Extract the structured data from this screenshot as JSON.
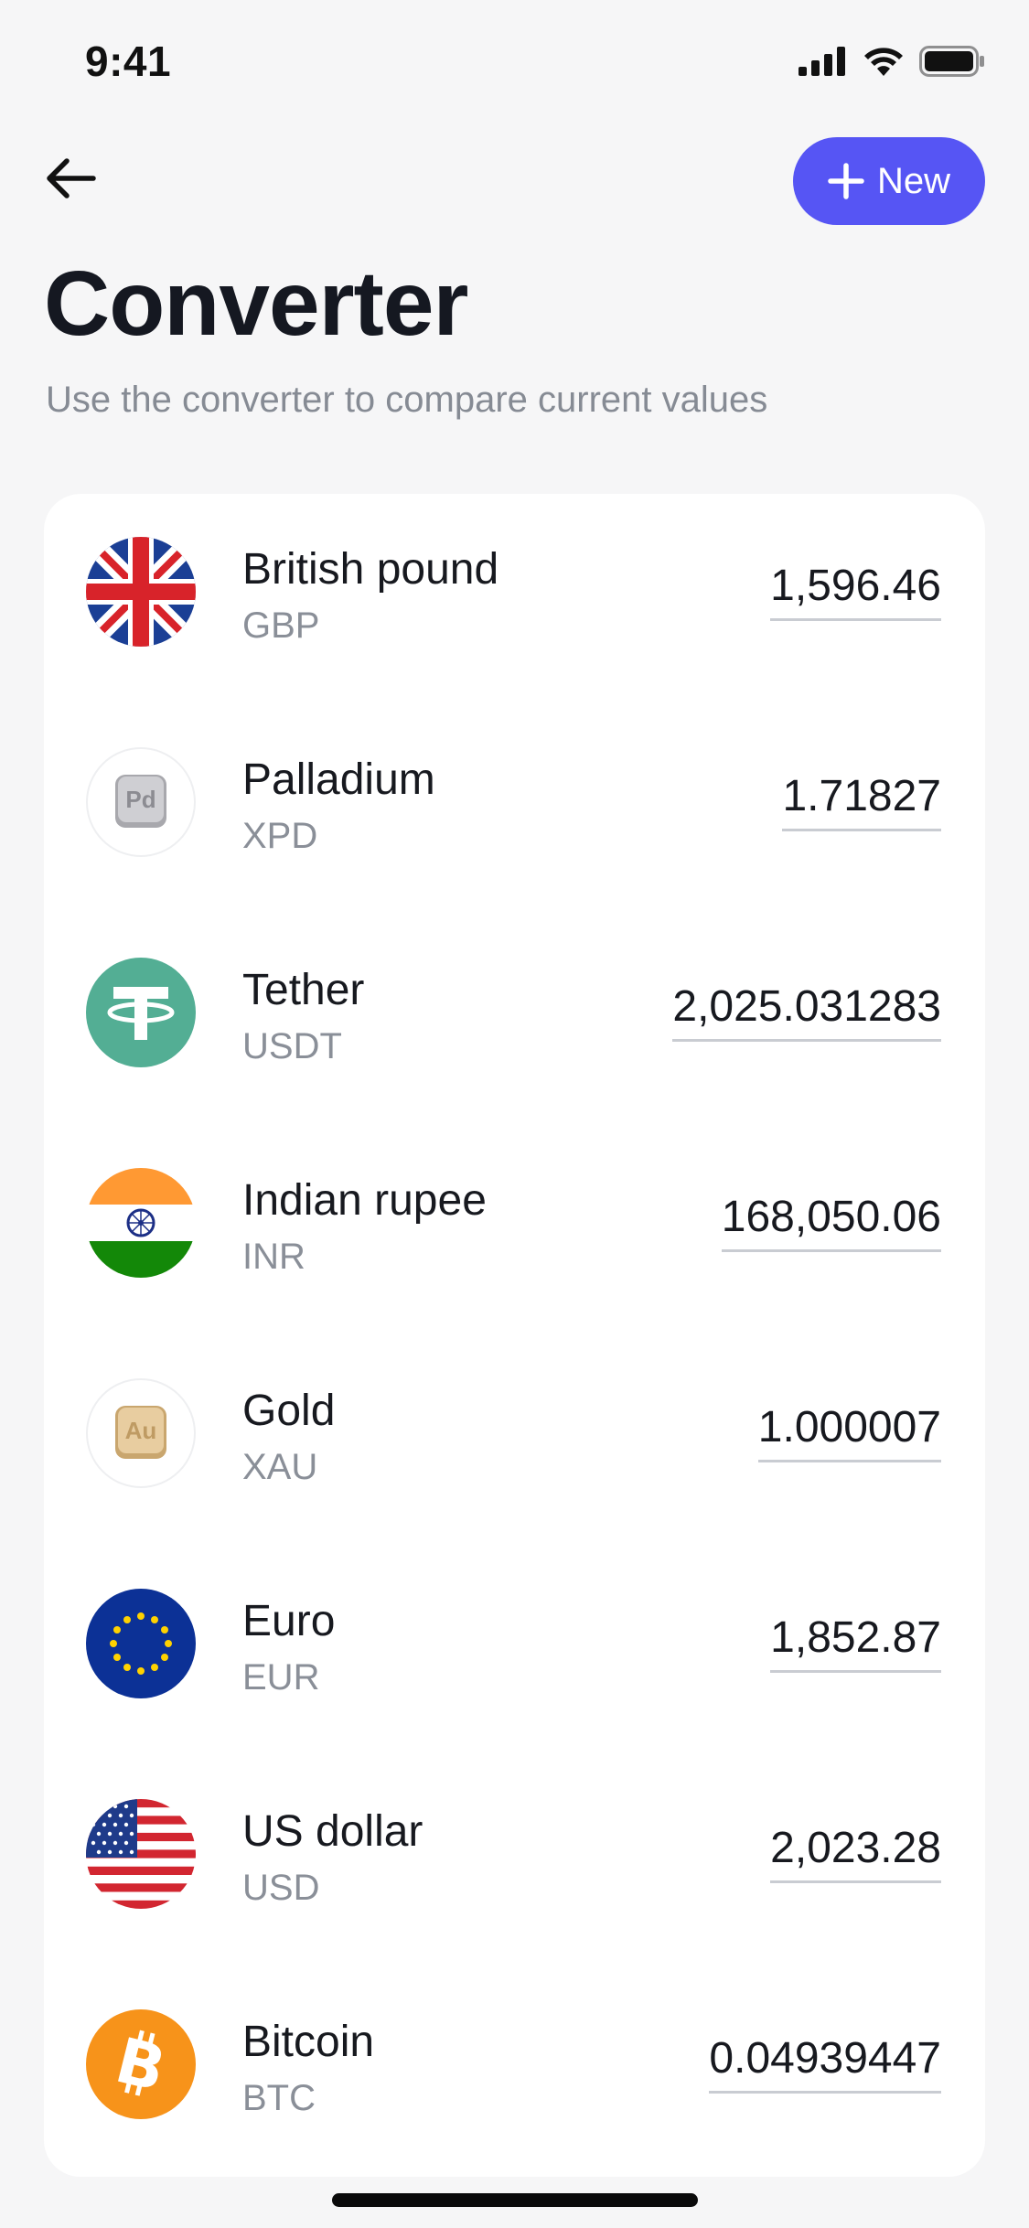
{
  "status_bar": {
    "time": "9:41"
  },
  "header": {
    "new_button_label": "New",
    "title": "Converter",
    "subtitle": "Use the converter to compare current values"
  },
  "currencies": [
    {
      "name": "British pound",
      "code": "GBP",
      "amount": "1,596.46",
      "icon": "uk-flag-icon"
    },
    {
      "name": "Palladium",
      "code": "XPD",
      "amount": "1.71827",
      "icon": "palladium-bar-icon",
      "icon_text": "Pd"
    },
    {
      "name": "Tether",
      "code": "USDT",
      "amount": "2,025.031283",
      "icon": "tether-icon"
    },
    {
      "name": "Indian rupee",
      "code": "INR",
      "amount": "168,050.06",
      "icon": "india-flag-icon"
    },
    {
      "name": "Gold",
      "code": "XAU",
      "amount": "1.000007",
      "icon": "gold-bar-icon",
      "icon_text": "Au"
    },
    {
      "name": "Euro",
      "code": "EUR",
      "amount": "1,852.87",
      "icon": "eu-flag-icon"
    },
    {
      "name": "US dollar",
      "code": "USD",
      "amount": "2,023.28",
      "icon": "us-flag-icon"
    },
    {
      "name": "Bitcoin",
      "code": "BTC",
      "amount": "0.04939447",
      "icon": "bitcoin-icon"
    }
  ],
  "colors": {
    "accent": "#5655f4",
    "tether": "#53ae94",
    "bitcoin": "#f7931a",
    "eu_blue": "#0c3196",
    "india_saffron": "#ff9933",
    "india_green": "#138808"
  }
}
